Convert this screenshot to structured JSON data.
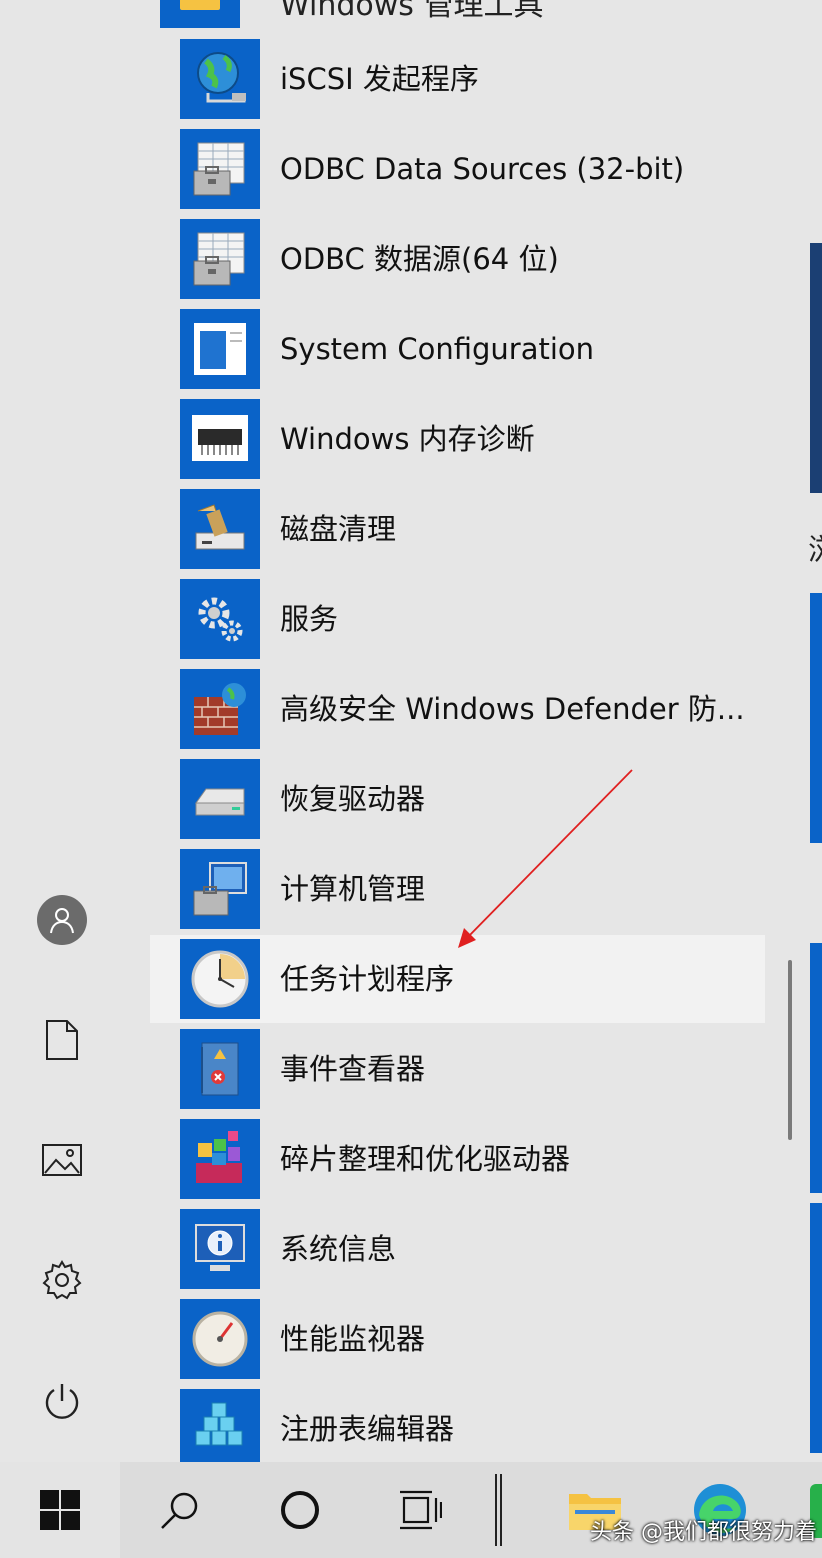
{
  "group": {
    "label": "Windows 管理工具"
  },
  "apps": [
    {
      "label": "iSCSI 发起程序",
      "icon": "globe-network-icon"
    },
    {
      "label": "ODBC Data Sources (32-bit)",
      "icon": "odbc-toolbox-icon"
    },
    {
      "label": "ODBC 数据源(64 位)",
      "icon": "odbc-toolbox-icon"
    },
    {
      "label": "System Configuration",
      "icon": "window-config-icon"
    },
    {
      "label": "Windows 内存诊断",
      "icon": "memory-chip-icon"
    },
    {
      "label": "磁盘清理",
      "icon": "disk-cleanup-icon"
    },
    {
      "label": "服务",
      "icon": "gears-icon"
    },
    {
      "label": "高级安全 Windows Defender 防...",
      "icon": "firewall-icon"
    },
    {
      "label": "恢复驱动器",
      "icon": "drive-icon"
    },
    {
      "label": "计算机管理",
      "icon": "computer-management-icon"
    },
    {
      "label": "任务计划程序",
      "icon": "clock-icon",
      "highlighted": true
    },
    {
      "label": "事件查看器",
      "icon": "event-log-icon"
    },
    {
      "label": "碎片整理和优化驱动器",
      "icon": "defrag-icon"
    },
    {
      "label": "系统信息",
      "icon": "info-monitor-icon"
    },
    {
      "label": "性能监视器",
      "icon": "gauge-icon"
    },
    {
      "label": "注册表编辑器",
      "icon": "registry-cubes-icon"
    }
  ],
  "right_edge_char": "浏",
  "colors": {
    "tile": "#0a63c8",
    "background": "#e6e6e6",
    "arrow": "#e02020",
    "highlight": "#f2f2f2"
  },
  "watermark": "头条 @我们都很努力着"
}
